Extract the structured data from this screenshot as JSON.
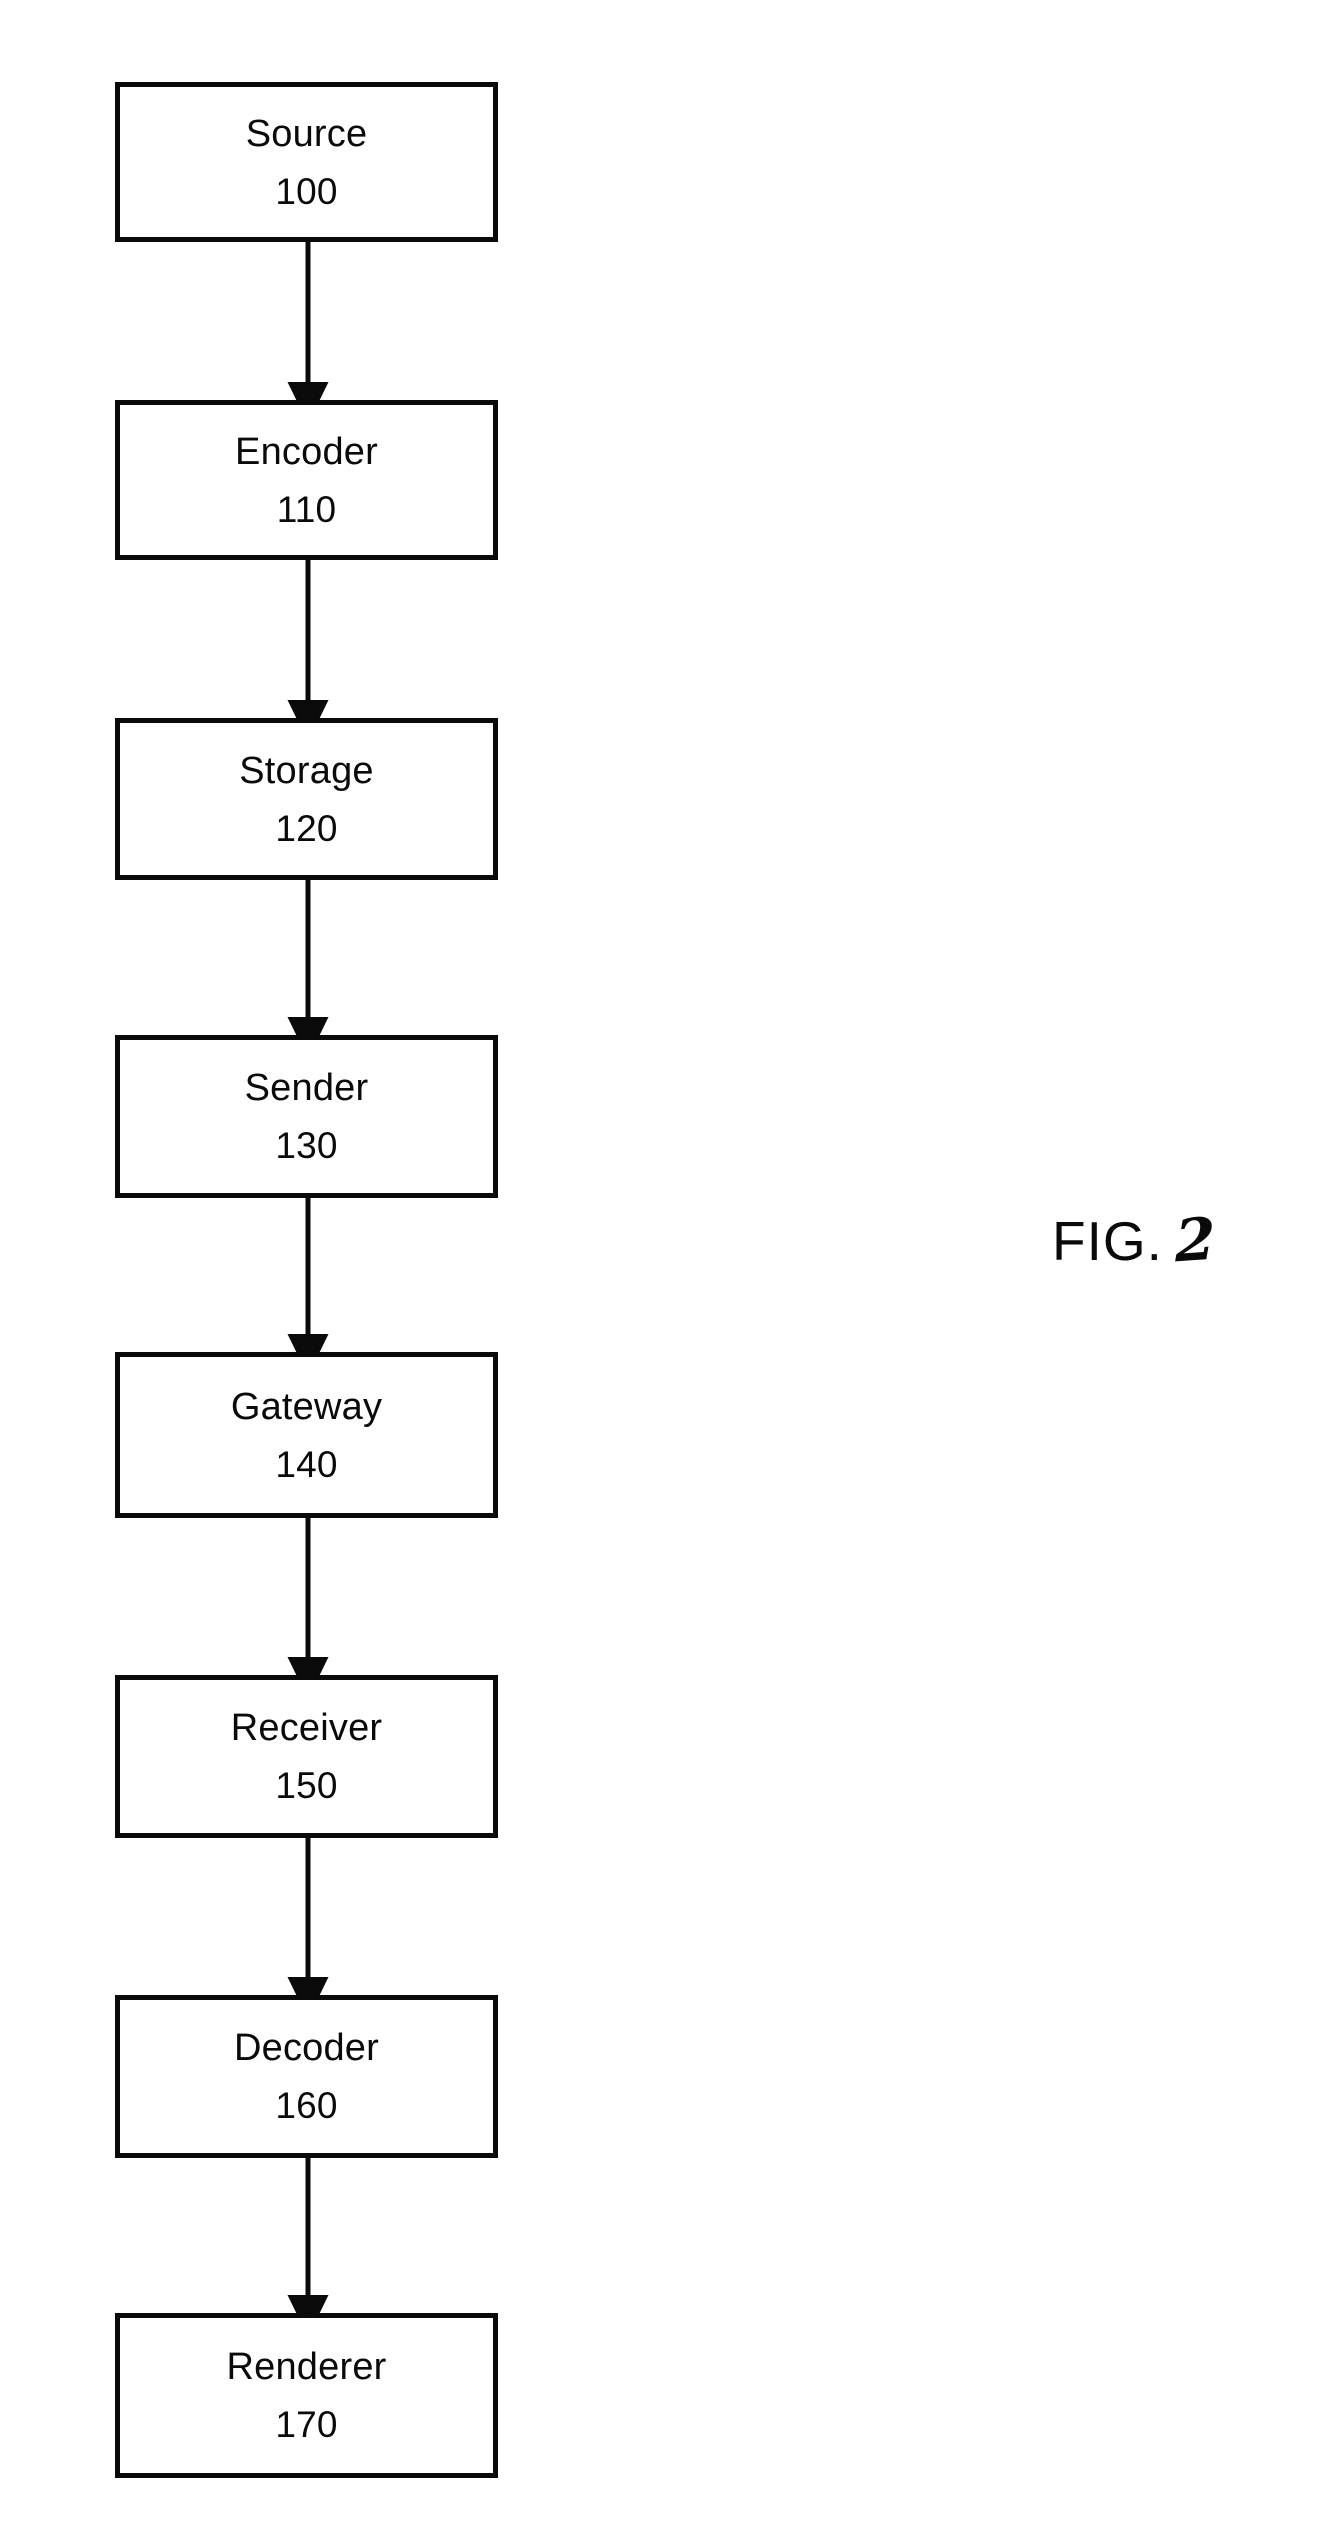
{
  "figure": {
    "label_prefix": "FIG.",
    "label_number": "2",
    "type": "block-flow-diagram",
    "orientation": "vertical",
    "ink_color": "#0a0a0a",
    "background_color": "#ffffff"
  },
  "diagram": {
    "nodes": [
      {
        "title": "Source",
        "ref": "100"
      },
      {
        "title": "Encoder",
        "ref": "110"
      },
      {
        "title": "Storage",
        "ref": "120"
      },
      {
        "title": "Sender",
        "ref": "130"
      },
      {
        "title": "Gateway",
        "ref": "140"
      },
      {
        "title": "Receiver",
        "ref": "150"
      },
      {
        "title": "Decoder",
        "ref": "160"
      },
      {
        "title": "Renderer",
        "ref": "170"
      }
    ],
    "connectors": [
      {
        "from": "Source",
        "to": "Encoder",
        "arrow": "down"
      },
      {
        "from": "Encoder",
        "to": "Storage",
        "arrow": "down"
      },
      {
        "from": "Storage",
        "to": "Sender",
        "arrow": "down"
      },
      {
        "from": "Sender",
        "to": "Gateway",
        "arrow": "down"
      },
      {
        "from": "Gateway",
        "to": "Receiver",
        "arrow": "down"
      },
      {
        "from": "Receiver",
        "to": "Decoder",
        "arrow": "down"
      },
      {
        "from": "Decoder",
        "to": "Renderer",
        "arrow": "down"
      }
    ]
  }
}
